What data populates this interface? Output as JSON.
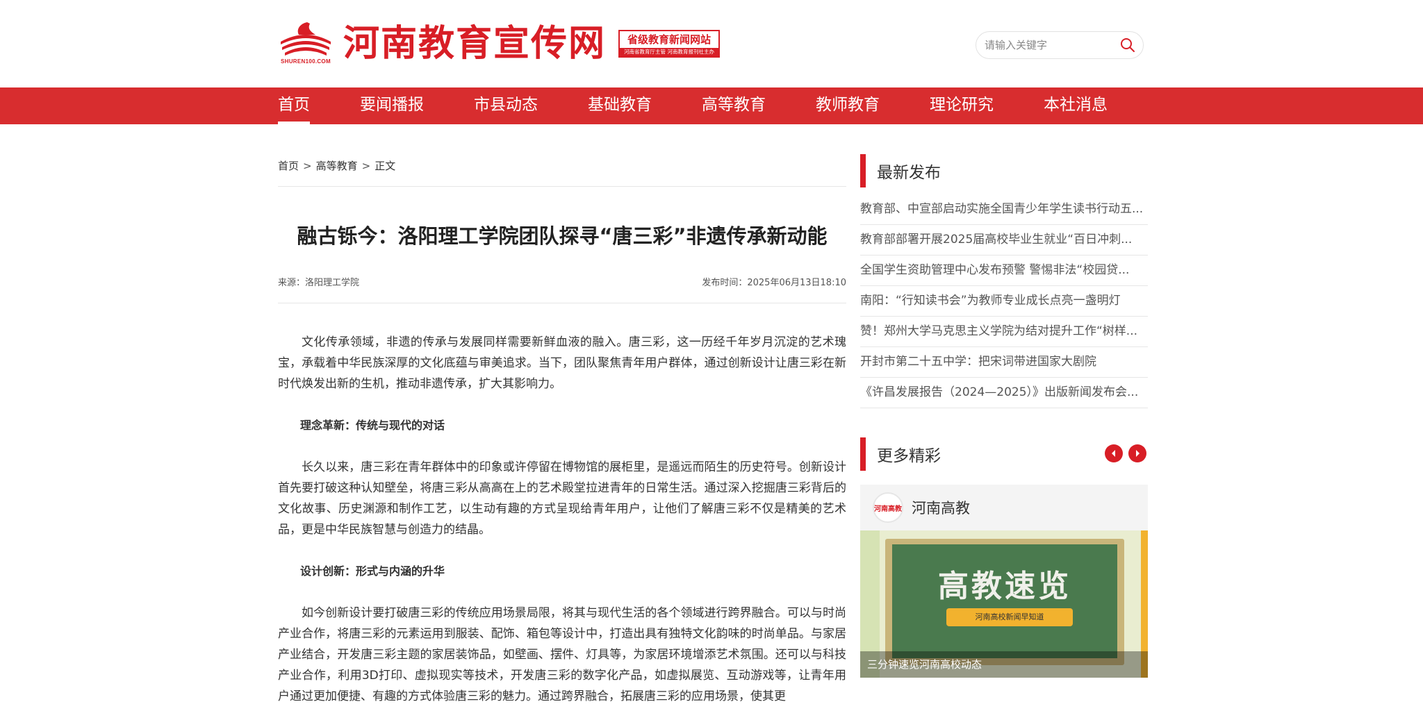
{
  "site": {
    "title": "河南教育宣传网",
    "logo_sub": "SHUREN100.COM",
    "badge_top": "省级教育新闻网站",
    "badge_bottom": "河南省教育厅主管 河南教育报刊社主办"
  },
  "search": {
    "placeholder": "请输入关键字"
  },
  "nav": {
    "items": [
      {
        "label": "首页"
      },
      {
        "label": "要闻播报"
      },
      {
        "label": "市县动态"
      },
      {
        "label": "基础教育"
      },
      {
        "label": "高等教育"
      },
      {
        "label": "教师教育"
      },
      {
        "label": "理论研究"
      },
      {
        "label": "本社消息"
      }
    ],
    "active": "首页"
  },
  "breadcrumb": {
    "home": "首页",
    "section": "高等教育",
    "current": "正文",
    "sep": ">"
  },
  "article": {
    "title": "融古铄今：洛阳理工学院团队探寻“唐三彩”非遗传承新动能",
    "source": "来源：洛阳理工学院",
    "published": "发布时间：2025年06月13日18:10",
    "paragraphs": [
      "文化传承领域，非遗的传承与发展同样需要新鲜血液的融入。唐三彩，这一历经千年岁月沉淀的艺术瑰宝，承载着中华民族深厚的文化底蕴与审美追求。当下，团队聚焦青年用户群体，通过创新设计让唐三彩在新时代焕发出新的生机，推动非遗传承，扩大其影响力。",
      "理念革新：传统与现代的对话",
      "长久以来，唐三彩在青年群体中的印象或许停留在博物馆的展柜里，是遥远而陌生的历史符号。创新设计首先要打破这种认知壁垒，将唐三彩从高高在上的艺术殿堂拉进青年的日常生活。通过深入挖掘唐三彩背后的文化故事、历史渊源和制作工艺，以生动有趣的方式呈现给青年用户，让他们了解唐三彩不仅是精美的艺术品，更是中华民族智慧与创造力的结晶。",
      "设计创新：形式与内涵的升华",
      "如今创新设计要打破唐三彩的传统应用场景局限，将其与现代生活的各个领域进行跨界融合。可以与时尚产业合作，将唐三彩的元素运用到服装、配饰、箱包等设计中，打造出具有独特文化韵味的时尚单品。与家居产业结合，开发唐三彩主题的家居装饰品，如壁画、摆件、灯具等，为家居环境增添艺术氛围。还可以与科技产业合作，利用3D打印、虚拟现实等技术，开发唐三彩的数字化产品，如虚拟展览、互动游戏等，让青年用户通过更加便捷、有趣的方式体验唐三彩的魅力。通过跨界融合，拓展唐三彩的应用场景，使其更"
    ]
  },
  "sidebar": {
    "latest_title": "最新发布",
    "latest": [
      "教育部、中宣部启动实施全国青少年学生读书行动五...",
      "教育部部署开展2025届高校毕业生就业“百日冲刺...",
      "全国学生资助管理中心发布预警 警惕非法“校园贷...",
      "南阳：“行知读书会”为教师专业成长点亮一盏明灯",
      "赞！郑州大学马克思主义学院为结对提升工作“树样...",
      "开封市第二十五中学：把宋词带进国家大剧院",
      "《许昌发展报告（2024—2025）》出版新闻发布会..."
    ],
    "more_title": "更多精彩",
    "card": {
      "avatar_text": "河南高教",
      "name": "河南高教",
      "board_title": "高教速览",
      "board_banner": "河南高校新闻早知道",
      "caption": "三分钟速览河南高校动态"
    }
  },
  "colors": {
    "brand_red": "#d81e26",
    "nav_red": "#d82d2f"
  }
}
